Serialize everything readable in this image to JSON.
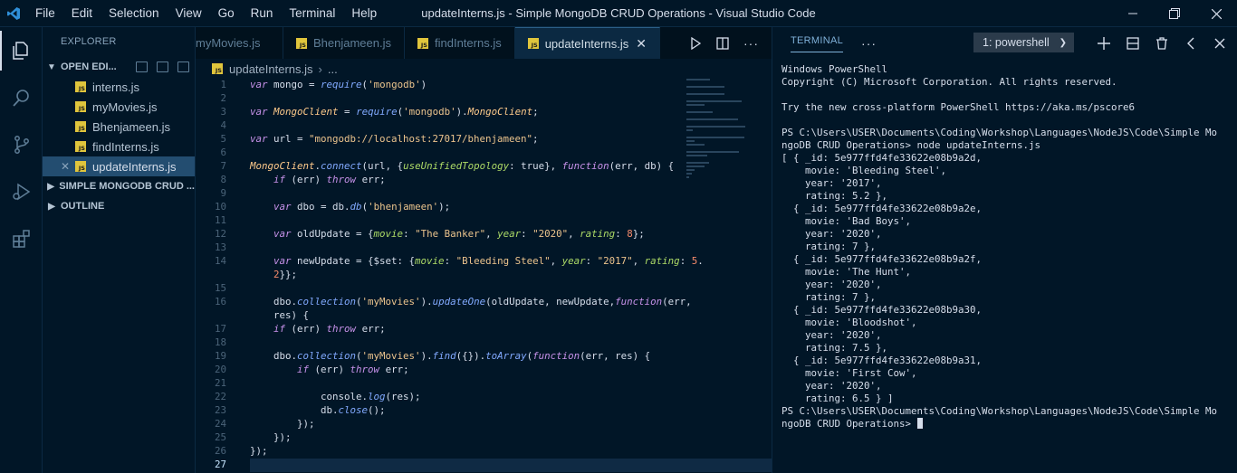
{
  "titlebar": {
    "title": "updateInterns.js - Simple MongoDB CRUD Operations - Visual Studio Code",
    "menu": [
      "File",
      "Edit",
      "Selection",
      "View",
      "Go",
      "Run",
      "Terminal",
      "Help"
    ]
  },
  "activity": [
    "explorer-icon",
    "search-icon",
    "source-control-icon",
    "run-debug-icon",
    "extensions-icon"
  ],
  "sidebar": {
    "title": "EXPLORER",
    "open_editors_label": "OPEN EDI...",
    "open_files": [
      "interns.js",
      "myMovies.js",
      "Bhenjameen.js",
      "findInterns.js",
      "updateInterns.js"
    ],
    "project_label": "SIMPLE MONGODB CRUD ...",
    "outline_label": "OUTLINE"
  },
  "editor": {
    "tabs": [
      "myMovies.js",
      "Bhenjameen.js",
      "findInterns.js",
      "updateInterns.js"
    ],
    "active_tab": "updateInterns.js",
    "breadcrumb_file": "updateInterns.js",
    "breadcrumb_more": "...",
    "code_lines": [
      {
        "n": "1",
        "text": "var mongo = require('mongodb')"
      },
      {
        "n": "2",
        "text": ""
      },
      {
        "n": "3",
        "text": "var MongoClient = require('mongodb').MongoClient;"
      },
      {
        "n": "4",
        "text": ""
      },
      {
        "n": "5",
        "text": "var url = \"mongodb://localhost:27017/bhenjameen\";"
      },
      {
        "n": "6",
        "text": ""
      },
      {
        "n": "7",
        "text": "MongoClient.connect(url, {useUnifiedTopology: true}, function(err, db) {"
      },
      {
        "n": "8",
        "text": "    if (err) throw err;"
      },
      {
        "n": "9",
        "text": ""
      },
      {
        "n": "10",
        "text": "    var dbo = db.db('bhenjameen');"
      },
      {
        "n": "11",
        "text": ""
      },
      {
        "n": "12",
        "text": "    var oldUpdate = {movie: \"The Banker\", year: \"2020\", rating: 8};"
      },
      {
        "n": "13",
        "text": ""
      },
      {
        "n": "14",
        "text": "    var newUpdate = {$set: {movie: \"Bleeding Steel\", year: \"2017\", rating: 5."
      },
      {
        "n": "",
        "text": "    2}};"
      },
      {
        "n": "15",
        "text": ""
      },
      {
        "n": "16",
        "text": "    dbo.collection('myMovies').updateOne(oldUpdate, newUpdate,function(err,"
      },
      {
        "n": "",
        "text": "    res) {"
      },
      {
        "n": "17",
        "text": "    if (err) throw err;"
      },
      {
        "n": "18",
        "text": ""
      },
      {
        "n": "19",
        "text": "    dbo.collection('myMovies').find({}).toArray(function(err, res) {"
      },
      {
        "n": "20",
        "text": "        if (err) throw err;"
      },
      {
        "n": "21",
        "text": ""
      },
      {
        "n": "22",
        "text": "            console.log(res);"
      },
      {
        "n": "23",
        "text": "            db.close();"
      },
      {
        "n": "24",
        "text": "        });"
      },
      {
        "n": "25",
        "text": "    });"
      },
      {
        "n": "26",
        "text": "});"
      },
      {
        "n": "27",
        "text": ""
      }
    ]
  },
  "panel": {
    "tab_label": "TERMINAL",
    "more": "···",
    "terminal_select": "1: powershell",
    "lines": [
      "Windows PowerShell",
      "Copyright (C) Microsoft Corporation. All rights reserved.",
      "",
      "Try the new cross-platform PowerShell https://aka.ms/pscore6",
      "",
      "PS C:\\Users\\USER\\Documents\\Coding\\Workshop\\Languages\\NodeJS\\Code\\Simple Mo",
      "ngoDB CRUD Operations> node updateInterns.js",
      "[ { _id: 5e977ffd4fe33622e08b9a2d,",
      "    movie: 'Bleeding Steel',",
      "    year: '2017',",
      "    rating: 5.2 },",
      "  { _id: 5e977ffd4fe33622e08b9a2e,",
      "    movie: 'Bad Boys',",
      "    year: '2020',",
      "    rating: 7 },",
      "  { _id: 5e977ffd4fe33622e08b9a2f,",
      "    movie: 'The Hunt',",
      "    year: '2020',",
      "    rating: 7 },",
      "  { _id: 5e977ffd4fe33622e08b9a30,",
      "    movie: 'Bloodshot',",
      "    year: '2020',",
      "    rating: 7.5 },",
      "  { _id: 5e977ffd4fe33622e08b9a31,",
      "    movie: 'First Cow',",
      "    year: '2020',",
      "    rating: 6.5 } ]",
      "PS C:\\Users\\USER\\Documents\\Coding\\Workshop\\Languages\\NodeJS\\Code\\Simple Mo",
      "ngoDB CRUD Operations> "
    ]
  },
  "colors": {
    "background": "#011627",
    "accent": "#1e88e5",
    "keyword": "#c792ea",
    "string": "#ecc48d",
    "function": "#82aaff",
    "property": "#addb67"
  }
}
